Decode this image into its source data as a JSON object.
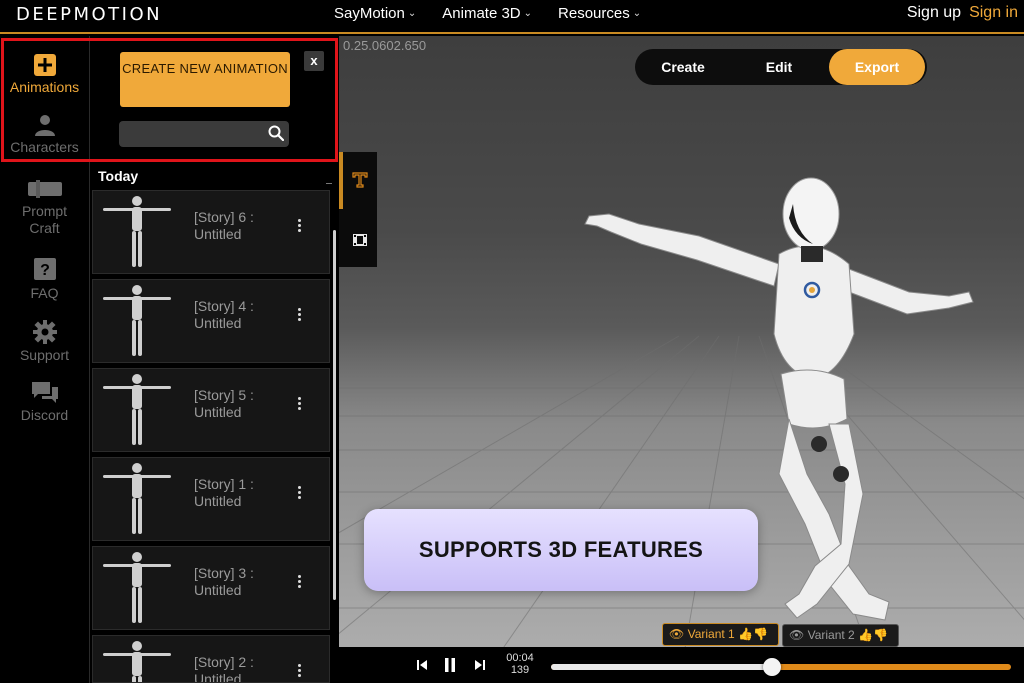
{
  "header": {
    "logo": "DEEPMOTION",
    "nav": [
      {
        "label": "SayMotion"
      },
      {
        "label": "Animate 3D"
      },
      {
        "label": "Resources"
      }
    ],
    "sign_up": "Sign up",
    "sign_in": "Sign in"
  },
  "rail": {
    "items": [
      {
        "label": "Animations",
        "icon": "plus-square-icon",
        "active": true
      },
      {
        "label": "Characters",
        "icon": "person-icon"
      },
      {
        "label": "Prompt Craft",
        "icon": "clapper-icon"
      },
      {
        "label": "FAQ",
        "icon": "question-icon"
      },
      {
        "label": "Support",
        "icon": "gear-icon"
      },
      {
        "label": "Discord",
        "icon": "chat-icon"
      }
    ]
  },
  "panel": {
    "create_label": "CREATE NEW ANIMATION",
    "close_label": "x",
    "search_placeholder": "",
    "section_label": "Today",
    "animations": [
      {
        "title": "[Story] 6 : Untitled"
      },
      {
        "title": "[Story] 4 : Untitled"
      },
      {
        "title": "[Story] 5 : Untitled"
      },
      {
        "title": "[Story] 1 : Untitled"
      },
      {
        "title": "[Story] 3 : Untitled"
      },
      {
        "title": "[Story] 2 : Untitled"
      }
    ]
  },
  "viewport": {
    "version": "0.25.0602.650",
    "modes": [
      {
        "label": "Create"
      },
      {
        "label": "Edit"
      },
      {
        "label": "Export",
        "active": true
      }
    ],
    "banner": "SUPPORTS 3D FEATURES",
    "variants": [
      {
        "label": "Variant 1",
        "active": true
      },
      {
        "label": "Variant 2"
      }
    ],
    "timeline": {
      "time": "00:04",
      "frame": "139",
      "progress": 0.48
    }
  },
  "colors": {
    "accent": "#f0a93a",
    "highlight_box": "#e0141a",
    "banner": "#d9d2fb"
  }
}
